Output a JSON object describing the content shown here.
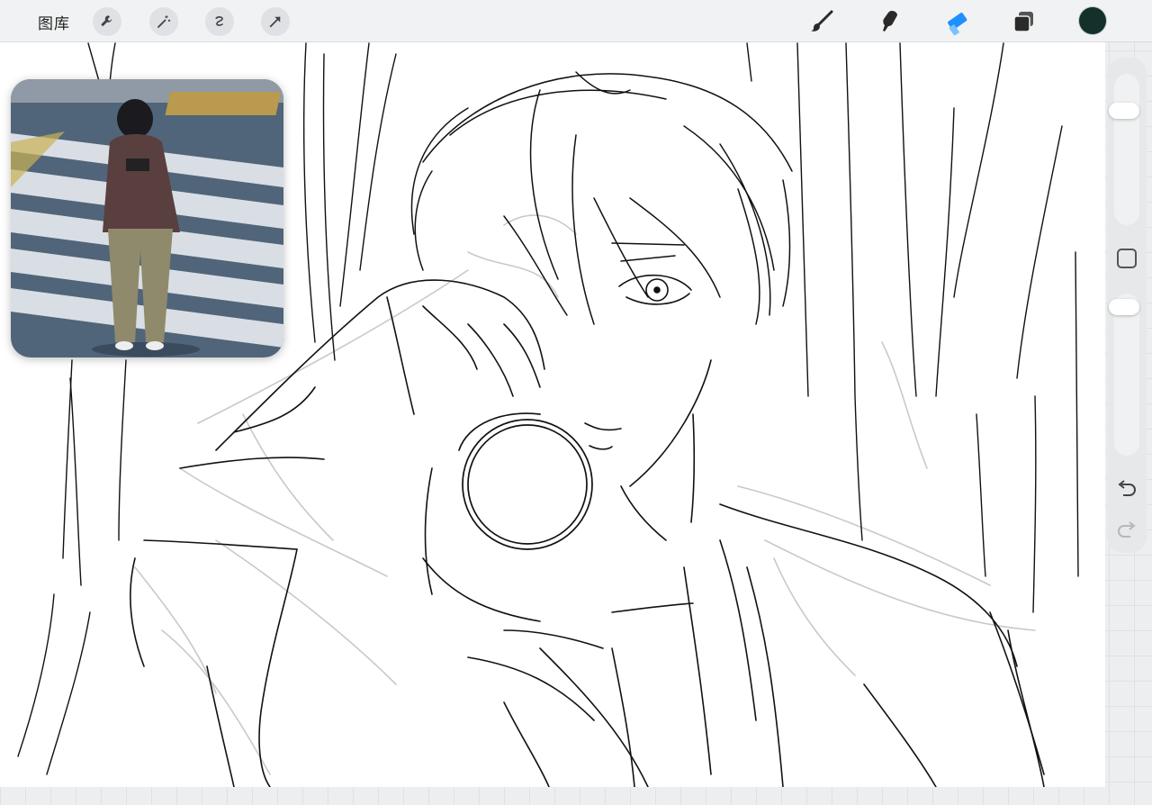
{
  "toolbar": {
    "gallery_label": "图库",
    "left_tools": [
      "wrench-icon",
      "magic-wand-icon",
      "selection-icon",
      "transform-arrow-icon"
    ],
    "right_tools": [
      "brush-icon",
      "smudge-icon",
      "eraser-icon",
      "layers-icon"
    ],
    "active_tool": "eraser-icon",
    "accent_color": "#1e90ff",
    "current_color": "#14302a"
  },
  "sidebar": {
    "size_slider_level": 0.12,
    "opacity_slider_level": 0.05
  }
}
